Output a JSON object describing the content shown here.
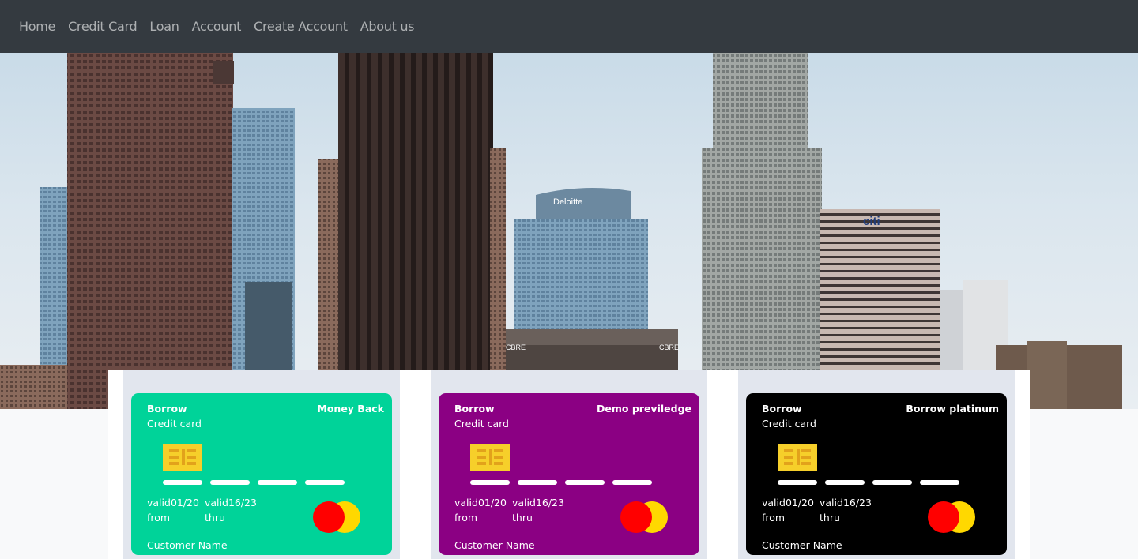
{
  "nav": {
    "items": [
      {
        "label": "Home"
      },
      {
        "label": "Credit Card"
      },
      {
        "label": "Loan"
      },
      {
        "label": "Account"
      },
      {
        "label": "Create Account"
      },
      {
        "label": "About us"
      }
    ]
  },
  "hero": {
    "image": "city-skyline",
    "signs": {
      "building1": "Deloitte",
      "building2": "citi",
      "building3": "CBRE",
      "building4": "CBRE"
    }
  },
  "cards": [
    {
      "brand": "Borrow",
      "type": "Credit card",
      "name": "Money Back",
      "valid_from": "valid01/20",
      "from_label": "from",
      "valid_thru": "valid16/23",
      "thru_label": "thru",
      "holder": "Customer Name",
      "color": "#00d399"
    },
    {
      "brand": "Borrow",
      "type": "Credit card",
      "name": "Demo previledge",
      "valid_from": "valid01/20",
      "from_label": "from",
      "valid_thru": "valid16/23",
      "thru_label": "thru",
      "holder": "Customer Name",
      "color": "#8b0083"
    },
    {
      "brand": "Borrow",
      "type": "Credit card",
      "name": "Borrow platinum",
      "valid_from": "valid01/20",
      "from_label": "from",
      "valid_thru": "valid16/23",
      "thru_label": "thru",
      "holder": "Customer Name",
      "color": "#000000"
    }
  ],
  "colors": {
    "navbar": "#343a40",
    "card_slot": "#e2e6ee",
    "chip": "#f6cf2a",
    "mc_red": "#ff0000",
    "mc_yellow": "#ffd800"
  }
}
